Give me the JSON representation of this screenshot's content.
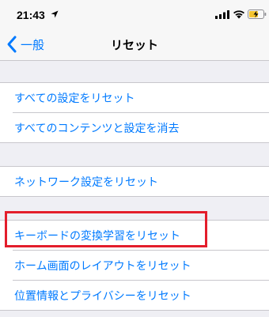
{
  "status_bar": {
    "time": "21:43",
    "icons": [
      "location-arrow-icon",
      "signal-icon",
      "wifi-icon",
      "battery-charging-icon"
    ]
  },
  "nav": {
    "back_label": "一般",
    "title": "リセット"
  },
  "colors": {
    "accent": "#007aff",
    "highlight": "#e31d2b",
    "background": "#efeff4"
  },
  "groups": [
    {
      "items": [
        "すべての設定をリセット",
        "すべてのコンテンツと設定を消去"
      ]
    },
    {
      "items": [
        "ネットワーク設定をリセット"
      ]
    },
    {
      "items": [
        "キーボードの変換学習をリセット",
        "ホーム画面のレイアウトをリセット",
        "位置情報とプライバシーをリセット"
      ]
    }
  ]
}
